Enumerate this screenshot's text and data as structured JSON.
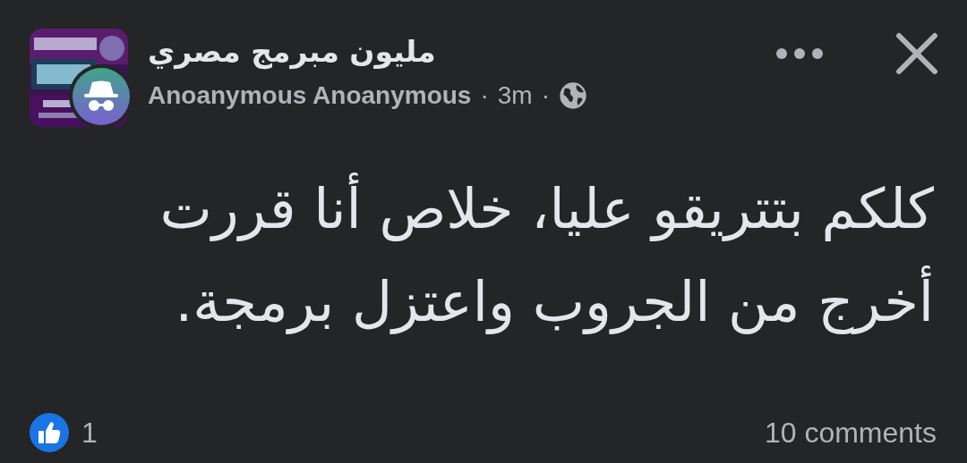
{
  "group": {
    "name": "مليون مبرمج مصري"
  },
  "author": {
    "name": "Anoanymous Anoanymous",
    "separator_1": "·",
    "time": "3m",
    "separator_2": "·"
  },
  "post": {
    "text": "كلكم بتتريقو عليا، خلاص أنا قررت\nأخرج من الجروب واعتزل برمجة."
  },
  "footer": {
    "reactions": "1",
    "comments": "10 comments"
  }
}
